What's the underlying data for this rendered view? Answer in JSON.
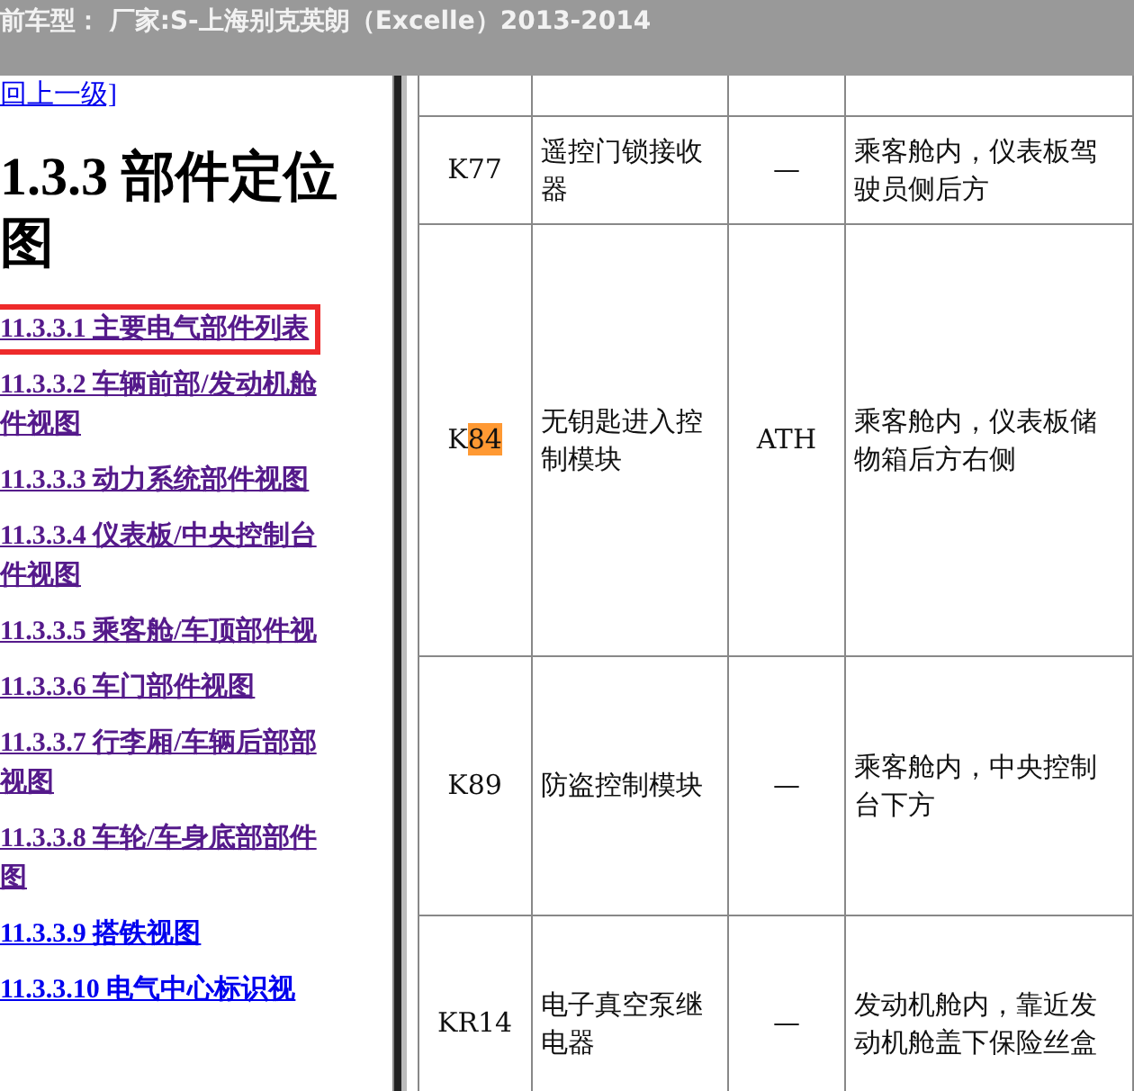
{
  "header": {
    "title": "前车型： 厂家:S-上海别克英朗（Excelle）2013-2014"
  },
  "sidebar": {
    "back_link": "回上一级]",
    "heading": "1.3.3 部件定位图",
    "links": [
      {
        "lines": [
          "11.3.3.1 主要电气部件列表"
        ],
        "visited": true,
        "selected": true
      },
      {
        "lines": [
          "11.3.3.2 车辆前部/发动机舱",
          "件视图"
        ],
        "visited": true,
        "selected": false
      },
      {
        "lines": [
          "11.3.3.3 动力系统部件视图"
        ],
        "visited": true,
        "selected": false
      },
      {
        "lines": [
          "11.3.3.4 仪表板/中央控制台",
          "件视图"
        ],
        "visited": true,
        "selected": false
      },
      {
        "lines": [
          "11.3.3.5 乘客舱/车顶部件视"
        ],
        "visited": true,
        "selected": false
      },
      {
        "lines": [
          "11.3.3.6 车门部件视图"
        ],
        "visited": true,
        "selected": false
      },
      {
        "lines": [
          "11.3.3.7 行李厢/车辆后部部",
          "视图"
        ],
        "visited": true,
        "selected": false
      },
      {
        "lines": [
          "11.3.3.8 车轮/车身底部部件",
          "图"
        ],
        "visited": true,
        "selected": false
      },
      {
        "lines": [
          "11.3.3.9 搭铁视图"
        ],
        "visited": false,
        "selected": false
      },
      {
        "lines": [
          "11.3.3.10 电气中心标识视"
        ],
        "visited": false,
        "selected": false
      }
    ]
  },
  "table": {
    "rows": [
      {
        "code": [],
        "name": "",
        "connector": "",
        "location": ""
      },
      {
        "code": [
          {
            "text": "K77",
            "highlighted": false
          }
        ],
        "name": "遥控门锁接收器",
        "connector": "—",
        "location": "乘客舱内，仪表板驾驶员侧后方"
      },
      {
        "code": [
          {
            "text": "K",
            "highlighted": false
          },
          {
            "text": "84",
            "highlighted": true
          }
        ],
        "name": "无钥匙进入控制模块",
        "connector": "ATH",
        "location": "乘客舱内，仪表板储物箱后方右侧"
      },
      {
        "code": [
          {
            "text": "K89",
            "highlighted": false
          }
        ],
        "name": "防盗控制模块",
        "connector": "—",
        "location": "乘客舱内，中央控制台下方"
      },
      {
        "code": [
          {
            "text": "KR14",
            "highlighted": false
          }
        ],
        "name": "电子真空泵继电器",
        "connector": "—",
        "location": "发动机舱内，靠近发动机舱盖下保险丝盒"
      }
    ]
  }
}
